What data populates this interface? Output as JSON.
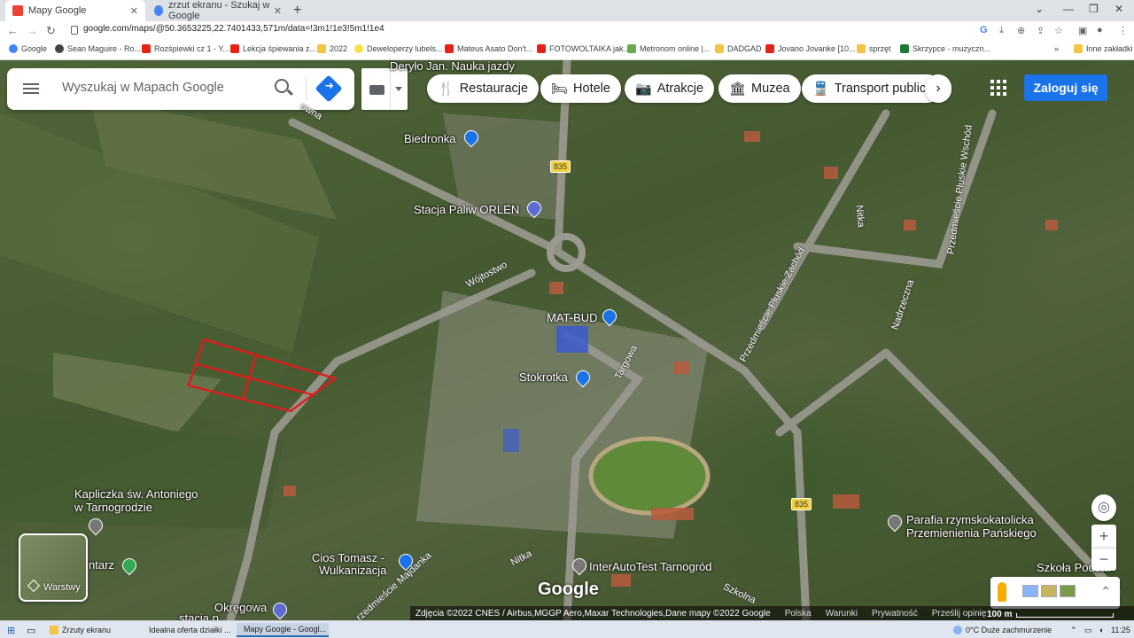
{
  "browser": {
    "tabs": [
      {
        "title": "Mapy Google",
        "active": true
      },
      {
        "title": "zrzut ekranu - Szukaj w Google",
        "active": false
      }
    ],
    "url": "google.com/maps/@50.3653225,22.7401433,571m/data=!3m1!1e3!5m1!1e4",
    "bookmarks": [
      "Google",
      "Sean Maguire - Ro...",
      "Rozśpiewki cz 1 - Y...",
      "Lekcja śpiewania z...",
      "2022",
      "Deweloperzy lubels...",
      "Mateus Asato Don't...",
      "FOTOWOLTAIKA jak...",
      "Metronom online |...",
      "DADGAD",
      "Jovano Jovanke [10...",
      "sprzęt",
      "Skrzypce - muzyczn...",
      "Inne zakładki"
    ]
  },
  "maps": {
    "search_placeholder": "Wyszukaj w Mapach Google",
    "chips": [
      "Restauracje",
      "Hotele",
      "Atrakcje",
      "Muzea",
      "Transport publiczny"
    ],
    "signin": "Zaloguj się",
    "layers": "Warstwy",
    "labels": {
      "deryło": "Deryło Jan. Nauka jazdy",
      "biedronka": "Biedronka",
      "orlen": "Stacja Paliw ORLEN",
      "matbud": "MAT-BUD",
      "stokrotka": "Stokrotka",
      "kapliczka1": "Kapliczka św. Antoniego",
      "kapliczka2": "w Tarnogrodzie",
      "cios1": "Cios Tomasz -",
      "cios2": "Wulkanizacja",
      "interauto": "InterAutoTest Tarnogród",
      "parafia1": "Parafia rzymskokatolicka",
      "parafia2": "Przemienienia Pańskiego",
      "szkola": "Szkoła Podsta",
      "okregowa1": "Okręgowa",
      "okregowa2": "stacja p",
      "cmentarz": "ntarz"
    },
    "streets": {
      "wojtostwo": "Wójtostwo",
      "targowa": "Targowa",
      "zachod": "Przedmieście Płuskie Zachód",
      "wschod": "Przedmieście Płuskie Wschód",
      "nitka": "Nitka",
      "nadrzeczna": "Nadrzeczna",
      "szkolna": "Szkolna",
      "majdanka": "rzedmieście Majdanka",
      "owna": "owna"
    },
    "road_number": "835",
    "google_logo": "Google",
    "attribution": "Zdjęcia ©2022 CNES / Airbus,MGGP Aero,Maxar Technologies,Dane mapy ©2022 Google",
    "footer_links": [
      "Polska",
      "Warunki",
      "Prywatność",
      "Prześlij opinię"
    ],
    "scale": "100 m"
  },
  "taskbar": {
    "items": [
      "Zrzuty ekranu",
      "Idealna oferta działki ...",
      "Mapy Google - Googl..."
    ],
    "weather": "0°C  Duże zachmurzenie",
    "time": "11:25"
  }
}
